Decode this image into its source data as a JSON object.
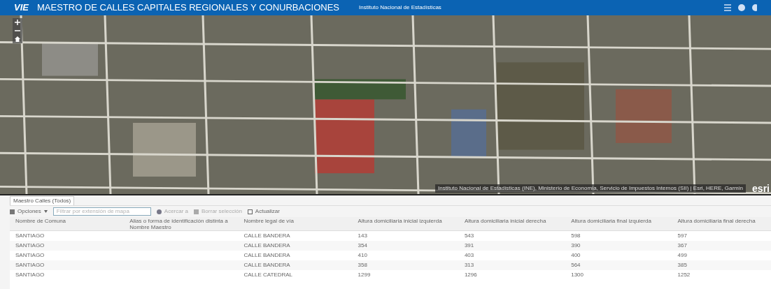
{
  "header": {
    "logo": "VIE",
    "title": "MAESTRO DE CALLES CAPITALES REGIONALES Y CONURBACIONES",
    "subtitle": "Instituto Nacional de Estadísticas"
  },
  "map": {
    "attribution": "Instituto Nacional de Estadísticas (INE), Ministerio de Economía, Servicio de Impuestos Internos (SII) | Esri, HERE, Garmin",
    "logo": "esri"
  },
  "panel": {
    "tabs": [
      {
        "label": "Maestro Calles (Todos)",
        "selected": true
      }
    ],
    "toolbar": {
      "options": "Opciones",
      "filter_placeholder": "Filtrar por extensión de mapa",
      "zoom": "Acercar a",
      "clear": "Borrar selección",
      "refresh": "Actualizar"
    },
    "table": {
      "columns": [
        "Nombre de Comuna",
        "Alias o forma de identificación distinta a Nombre Maestro",
        "Nombre legal de vía",
        "Altura domiciliaria inicial izquierda",
        "Altura domiciliaria inicial derecha",
        "Altura domiciliaria final izquierda",
        "Altura domiciliaria final derecha"
      ],
      "rows": [
        [
          "SANTIAGO",
          "",
          "CALLE BANDERA",
          "143",
          "543",
          "598",
          "597"
        ],
        [
          "SANTIAGO",
          "",
          "CALLE BANDERA",
          "354",
          "391",
          "390",
          "367"
        ],
        [
          "SANTIAGO",
          "",
          "CALLE BANDERA",
          "410",
          "403",
          "400",
          "499"
        ],
        [
          "SANTIAGO",
          "",
          "CALLE BANDERA",
          "358",
          "313",
          "564",
          "385"
        ],
        [
          "SANTIAGO",
          "",
          "CALLE CATEDRAL",
          "1299",
          "1296",
          "1300",
          "1252"
        ]
      ]
    }
  }
}
